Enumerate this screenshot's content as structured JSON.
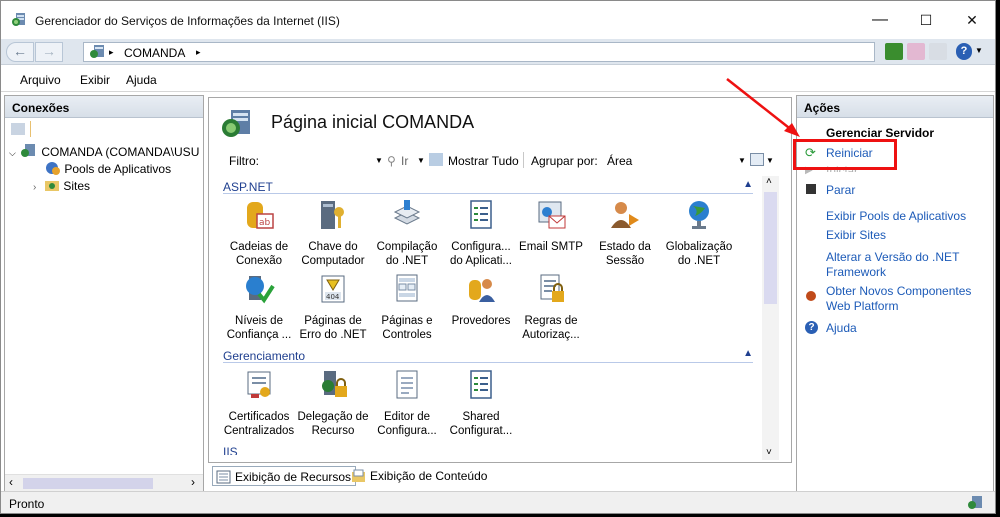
{
  "window": {
    "title": "Gerenciador do Serviços de Informações da Internet (IIS)",
    "controls": {
      "minimize": "—",
      "maximize": "☐",
      "close": "✕"
    }
  },
  "address": {
    "path": [
      "COMANDA"
    ],
    "separator": "▸"
  },
  "menu": [
    "Arquivo",
    "Exibir",
    "Ajuda"
  ],
  "connections": {
    "title": "Conexões",
    "tree": [
      {
        "label": "COMANDA (COMANDA\\USU",
        "expanded": true
      },
      {
        "label": "Pools de Aplicativos"
      },
      {
        "label": "Sites"
      }
    ]
  },
  "center": {
    "title": "Página inicial COMANDA",
    "filter": {
      "label": "Filtro:",
      "go": "Ir",
      "show_all": "Mostrar Tudo",
      "group_by": "Agrupar por:",
      "group_value": "Área"
    },
    "sections": [
      {
        "name": "ASP.NET",
        "items": [
          {
            "line1": "Cadeias de",
            "line2": "Conexão",
            "icon": "connection-strings-icon"
          },
          {
            "line1": "Chave do",
            "line2": "Computador",
            "icon": "machine-key-icon"
          },
          {
            "line1": "Compilação",
            "line2": "do .NET",
            "icon": "compilation-icon"
          },
          {
            "line1": "Configura...",
            "line2": "do Aplicati...",
            "icon": "app-settings-icon"
          },
          {
            "line1": "Email SMTP",
            "line2": "",
            "icon": "smtp-email-icon"
          },
          {
            "line1": "Estado da",
            "line2": "Sessão",
            "icon": "session-state-icon"
          },
          {
            "line1": "Globalização",
            "line2": "do .NET",
            "icon": "globalization-icon"
          },
          {
            "line1": "Níveis de",
            "line2": "Confiança ...",
            "icon": "trust-levels-icon"
          },
          {
            "line1": "Páginas de",
            "line2": "Erro do .NET",
            "icon": "error-pages-icon"
          },
          {
            "line1": "Páginas e",
            "line2": "Controles",
            "icon": "pages-controls-icon"
          },
          {
            "line1": "Provedores",
            "line2": "",
            "icon": "providers-icon"
          },
          {
            "line1": "Regras de",
            "line2": "Autorizaç...",
            "icon": "authorization-rules-icon"
          }
        ]
      },
      {
        "name": "Gerenciamento",
        "items": [
          {
            "line1": "Certificados",
            "line2": "Centralizados",
            "icon": "certificates-icon"
          },
          {
            "line1": "Delegação de",
            "line2": "Recurso",
            "icon": "feature-delegation-icon"
          },
          {
            "line1": "Editor de",
            "line2": "Configura...",
            "icon": "config-editor-icon"
          },
          {
            "line1": "Shared",
            "line2": "Configurat...",
            "icon": "shared-config-icon"
          }
        ]
      },
      {
        "name": "IIS",
        "items": []
      }
    ],
    "tabs": [
      "Exibição de Recursos",
      "Exibição de Conteúdo"
    ]
  },
  "actions": {
    "title": "Ações",
    "group": "Gerenciar Servidor",
    "items": [
      {
        "label": "Reiniciar",
        "icon": "restart-icon",
        "enabled": true
      },
      {
        "label": "Iniciar",
        "icon": "start-icon",
        "enabled": false
      },
      {
        "label": "Parar",
        "icon": "stop-icon",
        "enabled": true
      },
      {
        "label": "Exibir Pools de Aplicativos",
        "enabled": true
      },
      {
        "label": "Exibir Sites",
        "enabled": true
      },
      {
        "label": "Alterar a Versão do .NET",
        "label2": "Framework",
        "enabled": true
      },
      {
        "label": "Obter Novos Componentes",
        "label2": "Web Platform",
        "icon": "web-platform-icon",
        "enabled": true
      },
      {
        "label": "Ajuda",
        "icon": "help-icon",
        "enabled": true
      }
    ]
  },
  "status": "Pronto",
  "colors": {
    "link": "#1d5bb8",
    "section": "#1f3f8f",
    "annotation": "#ee1111"
  }
}
